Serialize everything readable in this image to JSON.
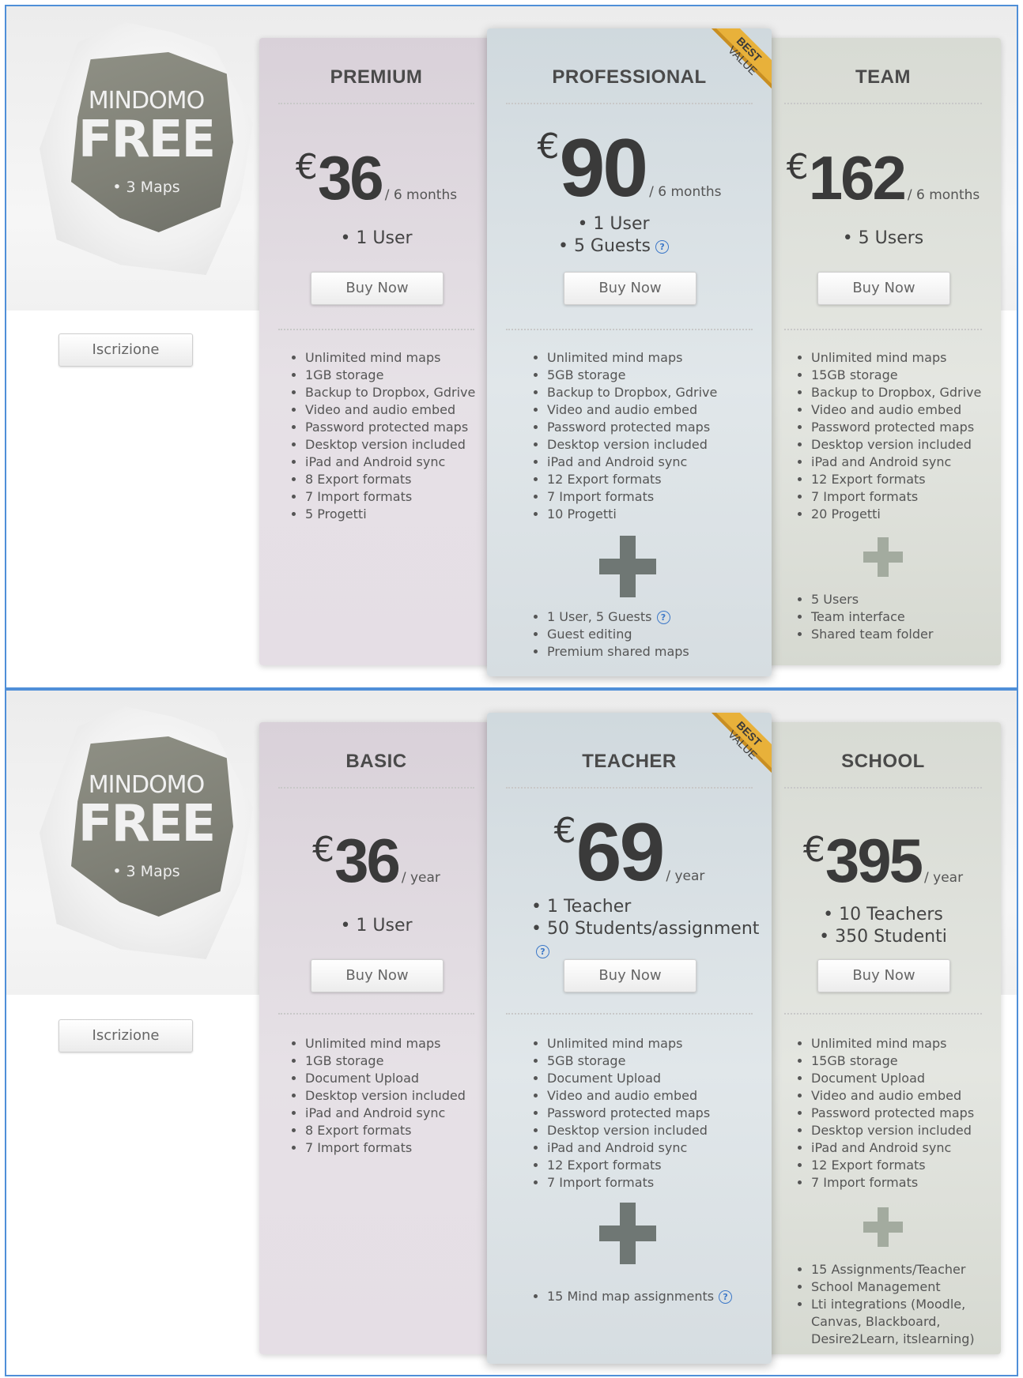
{
  "panels": [
    {
      "free": {
        "brand_top": "MINDOMO",
        "brand_main": "FREE",
        "maps": "• 3 Maps",
        "signup": "Iscrizione"
      },
      "plans": [
        {
          "name": "PREMIUM",
          "currency": "€",
          "amount": "36",
          "period": "/ 6 months",
          "users": [
            "• 1 User"
          ],
          "buy": "Buy Now",
          "features": [
            "Unlimited mind maps",
            "1GB storage",
            "Backup to Dropbox, Gdrive",
            "Video and audio embed",
            "Password protected maps",
            "Desktop version included",
            "iPad and Android sync",
            "8 Export formats",
            "7 Import formats",
            "5 Progetti"
          ],
          "extras": []
        },
        {
          "name": "PROFESSIONAL",
          "currency": "€",
          "amount": "90",
          "period": "/ 6 months",
          "users": [
            "• 1 User",
            "• 5 Guests"
          ],
          "buy": "Buy Now",
          "badge": "BEST VALUE",
          "features": [
            "Unlimited mind maps",
            "5GB storage",
            "Backup to Dropbox, Gdrive",
            "Video and audio embed",
            "Password protected maps",
            "Desktop version included",
            "iPad and Android sync",
            "12 Export formats",
            "7 Import formats",
            "10 Progetti"
          ],
          "extras": [
            "1 User, 5 Guests",
            "Guest editing",
            "Premium shared maps"
          ]
        },
        {
          "name": "TEAM",
          "currency": "€",
          "amount": "162",
          "period": "/ 6 months",
          "users": [
            "• 5 Users"
          ],
          "buy": "Buy Now",
          "features": [
            "Unlimited mind maps",
            "15GB storage",
            "Backup to Dropbox, Gdrive",
            "Video and audio embed",
            "Password protected maps",
            "Desktop version included",
            "iPad and Android sync",
            "12 Export formats",
            "7 Import formats",
            "20 Progetti"
          ],
          "extras": [
            "5 Users",
            "Team interface",
            "Shared team folder"
          ]
        }
      ]
    },
    {
      "free": {
        "brand_top": "MINDOMO",
        "brand_main": "FREE",
        "maps": "• 3 Maps",
        "signup": "Iscrizione"
      },
      "plans": [
        {
          "name": "BASIC",
          "currency": "€",
          "amount": "36",
          "period": "/ year",
          "users": [
            "• 1 User"
          ],
          "buy": "Buy Now",
          "features": [
            "Unlimited mind maps",
            "1GB storage",
            "Document Upload",
            "Desktop version included",
            "iPad and Android sync",
            "8 Export formats",
            "7 Import formats"
          ],
          "extras": []
        },
        {
          "name": "TEACHER",
          "currency": "€",
          "amount": "69",
          "period": "/ year",
          "users": [
            "• 1 Teacher",
            "• 50 Students/assignment"
          ],
          "buy": "Buy Now",
          "badge": "BEST VALUE",
          "features": [
            "Unlimited mind maps",
            "5GB storage",
            "Document Upload",
            "Video and audio embed",
            "Password protected maps",
            "Desktop version included",
            "iPad and Android sync",
            "12 Export formats",
            "7 Import formats"
          ],
          "extras": [
            "15 Mind map assignments"
          ]
        },
        {
          "name": "SCHOOL",
          "currency": "€",
          "amount": "395",
          "period": "/ year",
          "users": [
            "• 10 Teachers",
            "• 350 Studenti"
          ],
          "buy": "Buy Now",
          "features": [
            "Unlimited mind maps",
            "15GB storage",
            "Document Upload",
            "Video and audio embed",
            "Password protected maps",
            "Desktop version included",
            "iPad and Android sync",
            "12 Export formats",
            "7 Import formats"
          ],
          "extras": [
            "15 Assignments/Teacher",
            "School Management",
            "Lti integrations (Moodle, Canvas, Blackboard, Desire2Learn, itslearning)"
          ]
        }
      ]
    }
  ],
  "info_icon": "?",
  "colors": {
    "border": "#4f8fd8",
    "ribbon": "#e8b13a",
    "plus": "#6f7774",
    "plus_light": "#a3ab9f",
    "info": "#3c78c8"
  }
}
